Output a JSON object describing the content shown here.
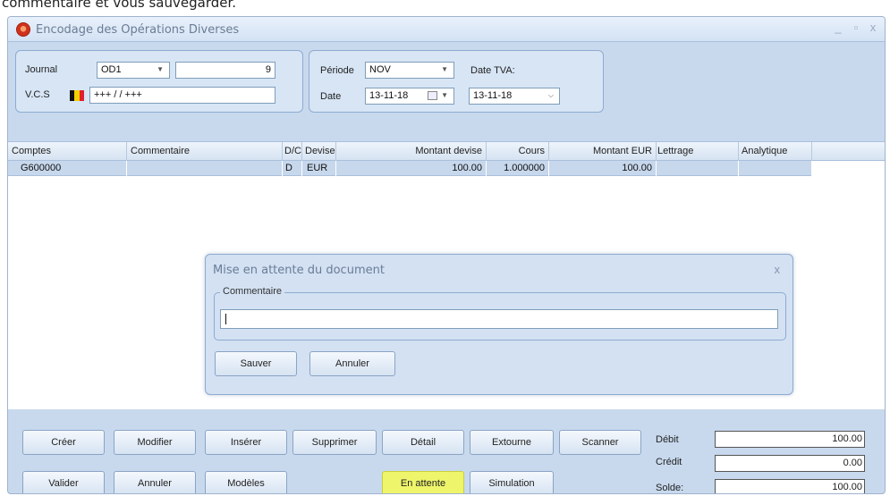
{
  "caption": "commentaire et vous sauvegarder.",
  "window": {
    "title": "Encodage des Opérations Diverses",
    "controls": [
      "_",
      "▫",
      "x"
    ]
  },
  "header": {
    "journal_label": "Journal",
    "journal_value": "OD1",
    "journal_number": "9",
    "vcs_label": "V.C.S",
    "vcs_value": "+++ / / +++",
    "periode_label": "Période",
    "periode_value": "NOV",
    "date_tva_label": "Date TVA:",
    "date_label": "Date",
    "date_value": "13-11-18",
    "date_tva_value": "13-11-18"
  },
  "grid": {
    "columns": [
      "Comptes",
      "Commentaire",
      "D/C",
      "Devise",
      "Montant devise",
      "Cours",
      "Montant EUR",
      "Lettrage",
      "Analytique"
    ],
    "rows": [
      {
        "compte": "G600000",
        "commentaire": "",
        "dc": "D",
        "devise": "EUR",
        "montant_devise": "100.00",
        "cours": "1.000000",
        "montant_eur": "100.00",
        "lettrage": "",
        "analytique": ""
      }
    ]
  },
  "dialog": {
    "title": "Mise en attente du document",
    "close": "x",
    "legend": "Commentaire",
    "input_value": "",
    "save_label": "Sauver",
    "cancel_label": "Annuler"
  },
  "buttons": {
    "creer": "Créer",
    "modifier": "Modifier",
    "inserer": "Insérer",
    "supprimer": "Supprimer",
    "detail": "Détail",
    "extourne": "Extourne",
    "scanner": "Scanner",
    "valider": "Valider",
    "annuler": "Annuler",
    "modeles": "Modèles",
    "en_attente": "En attente",
    "simulation": "Simulation"
  },
  "totals": {
    "debit_label": "Débit",
    "debit_value": "100.00",
    "credit_label": "Crédit",
    "credit_value": "0.00",
    "solde_label": "Solde:",
    "solde_value": "100.00"
  },
  "colors": {
    "window_bg": "#c8d9ee",
    "highlight_button": "#eef56b",
    "selected_row": "#c7d7ec"
  }
}
